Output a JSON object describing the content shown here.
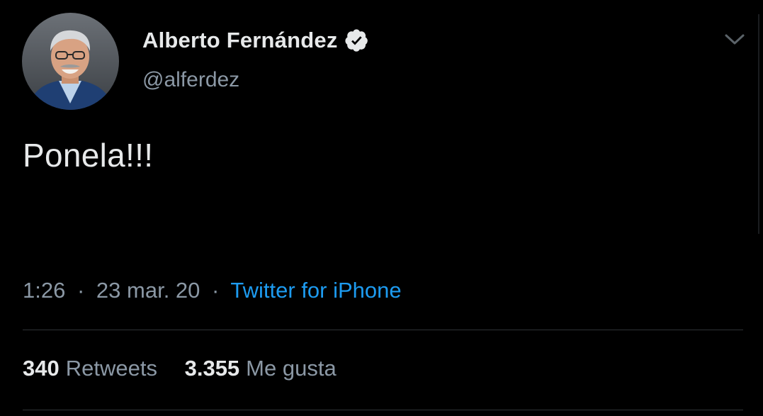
{
  "author": {
    "display_name": "Alberto Fernández",
    "handle": "@alferdez",
    "verified": true
  },
  "tweet": {
    "text": "Ponela!!!"
  },
  "meta": {
    "time": "1:26",
    "separator": "·",
    "date": "23 mar. 20",
    "source": "Twitter for iPhone"
  },
  "stats": {
    "retweets": {
      "count": "340",
      "label": "Retweets"
    },
    "likes": {
      "count": "3.355",
      "label": "Me gusta"
    }
  },
  "icons": {
    "verified": "verified-badge-icon",
    "menu": "chevron-down-icon"
  },
  "colors": {
    "background": "#000000",
    "primary_text": "#e7e9ea",
    "secondary_text": "#8b98a5",
    "accent": "#1d9bf0",
    "divider": "#2f3336"
  }
}
